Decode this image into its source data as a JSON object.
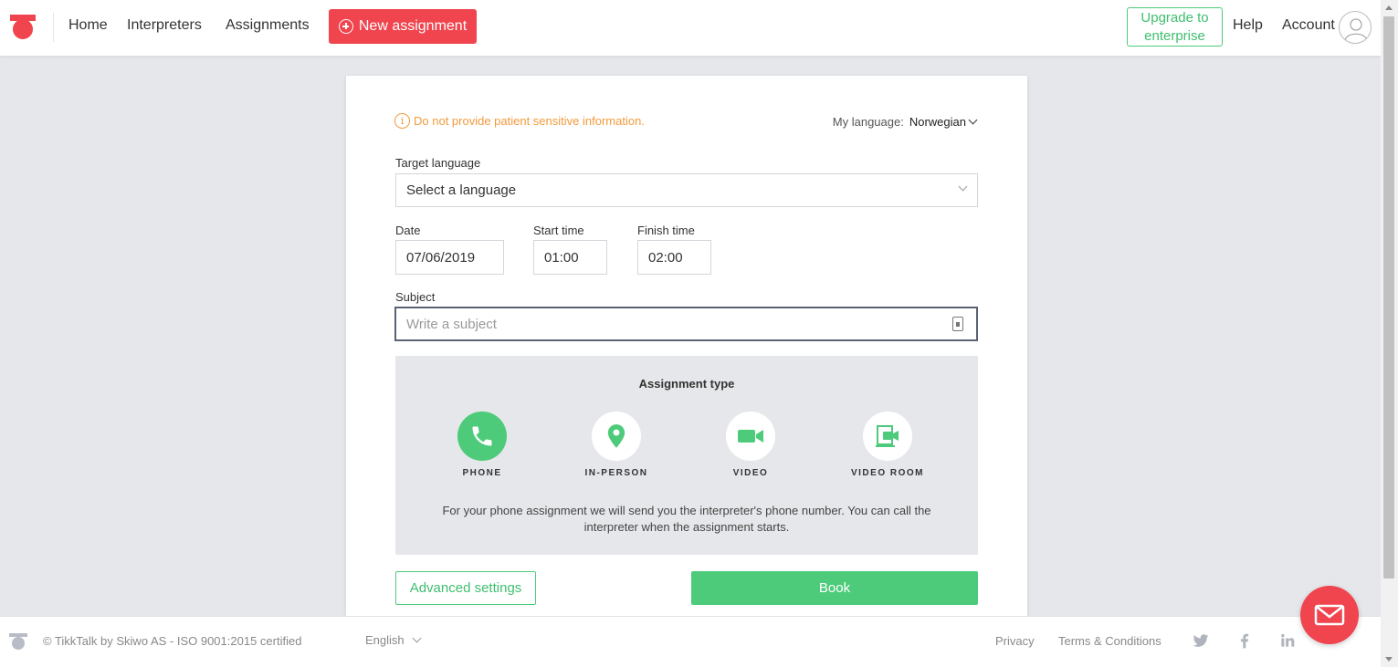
{
  "nav": {
    "home": "Home",
    "interpreters": "Interpreters",
    "assignments": "Assignments",
    "new_assignment": "New assignment",
    "upgrade_line1": "Upgrade to",
    "upgrade_line2": "enterprise",
    "help": "Help",
    "account": "Account"
  },
  "form": {
    "warning": "Do not provide patient sensitive information.",
    "my_language_label": "My language:",
    "my_language_value": "Norwegian",
    "target_language_label": "Target language",
    "target_language_value": "Select a language",
    "date_label": "Date",
    "date_value": "07/06/2019",
    "start_time_label": "Start time",
    "start_time_value": "01:00",
    "finish_time_label": "Finish time",
    "finish_time_value": "02:00",
    "subject_label": "Subject",
    "subject_placeholder": "Write a subject",
    "assignment_type_title": "Assignment type",
    "types": [
      {
        "label": "PHONE",
        "icon": "phone-icon",
        "selected": true
      },
      {
        "label": "IN-PERSON",
        "icon": "location-pin-icon",
        "selected": false
      },
      {
        "label": "VIDEO",
        "icon": "video-camera-icon",
        "selected": false
      },
      {
        "label": "VIDEO ROOM",
        "icon": "video-room-icon",
        "selected": false
      }
    ],
    "type_description_line1": "For your phone assignment we will send you the interpreter's phone number. You can call the",
    "type_description_line2": "interpreter when the assignment starts.",
    "advanced_settings": "Advanced settings",
    "book": "Book"
  },
  "footer": {
    "copyright": "© TikkTalk by Skiwo AS - ISO 9001:2015 certified",
    "language": "English",
    "privacy": "Privacy",
    "terms": "Terms & Conditions"
  },
  "colors": {
    "brand_red": "#f0444e",
    "accent_green": "#4dcb7a",
    "warning_orange": "#f29a3d",
    "panel_gray": "#e6e7ea"
  }
}
